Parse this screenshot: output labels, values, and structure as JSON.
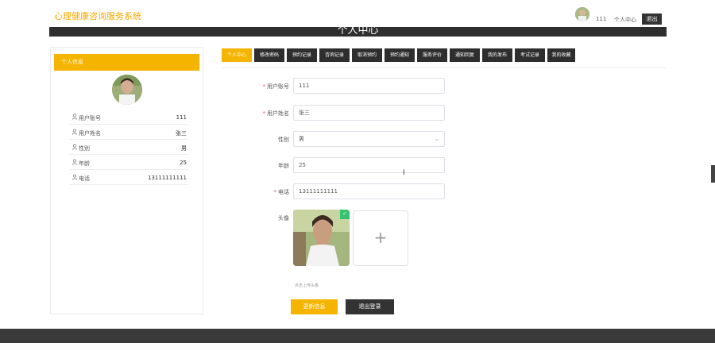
{
  "header": {
    "site_title": "心理健康咨询服务系统",
    "username": "111",
    "personal_center": "个人中心",
    "logout": "退出"
  },
  "banner": {
    "title": "个人中心"
  },
  "left_panel": {
    "title": "个人信息",
    "rows": [
      {
        "label": "用户账号",
        "value": "111",
        "icon": "user-icon"
      },
      {
        "label": "用户姓名",
        "value": "张三",
        "icon": "user-icon"
      },
      {
        "label": "性别",
        "value": "男",
        "icon": "user-icon"
      },
      {
        "label": "年龄",
        "value": "25",
        "icon": "user-icon"
      },
      {
        "label": "电话",
        "value": "13111111111",
        "icon": "user-icon"
      }
    ]
  },
  "tabs": [
    {
      "label": "个人中心",
      "active": true
    },
    {
      "label": "修改密码"
    },
    {
      "label": "预约记录"
    },
    {
      "label": "咨询记录"
    },
    {
      "label": "取消预约"
    },
    {
      "label": "预约通知"
    },
    {
      "label": "服务评价"
    },
    {
      "label": "通知回复"
    },
    {
      "label": "我的发布"
    },
    {
      "label": "考试记录"
    },
    {
      "label": "我的收藏"
    }
  ],
  "form": {
    "account_label": "用户账号",
    "account_value": "111",
    "name_label": "用户姓名",
    "name_value": "张三",
    "gender_label": "性别",
    "gender_value": "男",
    "age_label": "年龄",
    "age_value": "25",
    "phone_label": "电话",
    "phone_value": "13111111111",
    "avatar_label": "头像",
    "upload_tip": "点击上传头像",
    "update_button": "更新信息",
    "logout_button": "退出登录"
  },
  "colors": {
    "accent": "#f5b400",
    "dark": "#2e2e2e",
    "required": "#e5484d"
  }
}
